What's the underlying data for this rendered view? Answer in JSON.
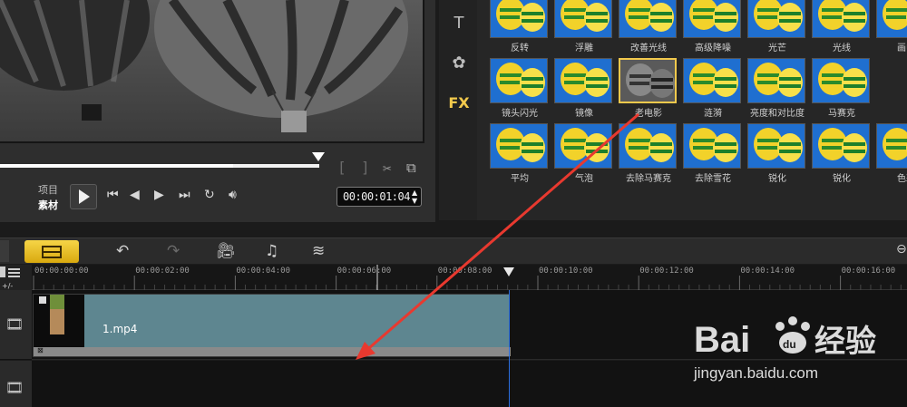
{
  "preview": {
    "mode_labels": [
      "项目",
      "素材"
    ],
    "trim_in": "[",
    "trim_out": "]",
    "timecode": "00:00:01:04",
    "progress": 0.73
  },
  "library": {
    "tabs": [
      {
        "name": "title-tab",
        "glyph": "T"
      },
      {
        "name": "transition-tab",
        "glyph": "✿"
      },
      {
        "name": "fx-tab",
        "glyph": "FX"
      }
    ],
    "fx_rows": [
      [
        "反转",
        "浮雕",
        "改善光线",
        "高级降噪",
        "光芒",
        "光线",
        "画中"
      ],
      [
        "镜头闪光",
        "镜像",
        "老电影",
        "涟漪",
        "亮度和对比度",
        "马赛克",
        ""
      ],
      [
        "平均",
        "气泡",
        "去除马赛克",
        "去除雪花",
        "锐化",
        "锐化",
        "色彩"
      ]
    ],
    "selected_fx": "老电影"
  },
  "toolbar": {
    "tools": [
      "undo",
      "redo",
      "record-capture",
      "audio-mixer",
      "auto-music"
    ]
  },
  "ruler": {
    "ticks": [
      "00:00:00:00",
      "00:00:02:00",
      "00:00:04:00",
      "00:00:06:00",
      "00:00:08:00",
      "00:00:10:00",
      "00:00:12:00",
      "00:00:14:00",
      "00:00:16:00"
    ]
  },
  "timeline": {
    "clip_name": "1.mp4",
    "clip_end_seconds": 9.4
  },
  "watermark": {
    "url": "jingyan.baidu.com"
  },
  "colors": {
    "accent": "#f2c94c",
    "clip": "#5e8690",
    "playhead": "#2b6fe0",
    "annotation_arrow": "#e8392f"
  }
}
